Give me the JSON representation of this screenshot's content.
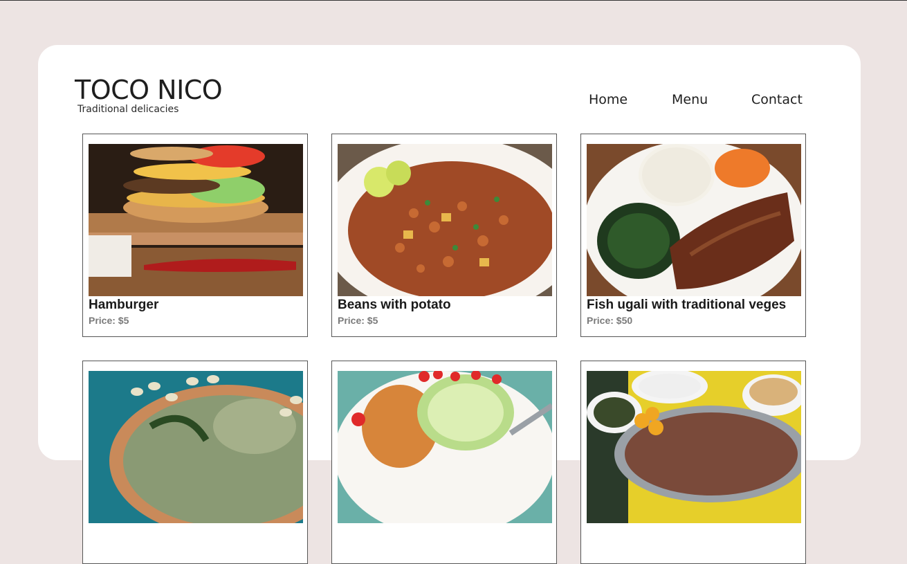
{
  "brand": {
    "title": "TOCO NICO",
    "subtitle": "Traditional delicacies"
  },
  "nav": {
    "items": [
      {
        "label": "Home"
      },
      {
        "label": "Menu"
      },
      {
        "label": "Contact"
      }
    ]
  },
  "menu": {
    "items": [
      {
        "name": "Hamburger",
        "price": "Price: $5",
        "image": "hamburger-photo"
      },
      {
        "name": "Beans with potato",
        "price": "Price: $5",
        "image": "beans-potato-photo"
      },
      {
        "name": "Fish ugali with traditional veges",
        "price": "Price: $50",
        "image": "fish-ugali-photo"
      },
      {
        "name": "",
        "price": "",
        "image": "greens-dish-photo"
      },
      {
        "name": "",
        "price": "",
        "image": "rice-salad-photo"
      },
      {
        "name": "",
        "price": "",
        "image": "meat-platter-photo"
      }
    ]
  },
  "colors": {
    "page_bg": "#ede4e3",
    "card_bg": "#ffffff",
    "text": "#1e1e1e",
    "price_text": "#7a7a7a"
  }
}
